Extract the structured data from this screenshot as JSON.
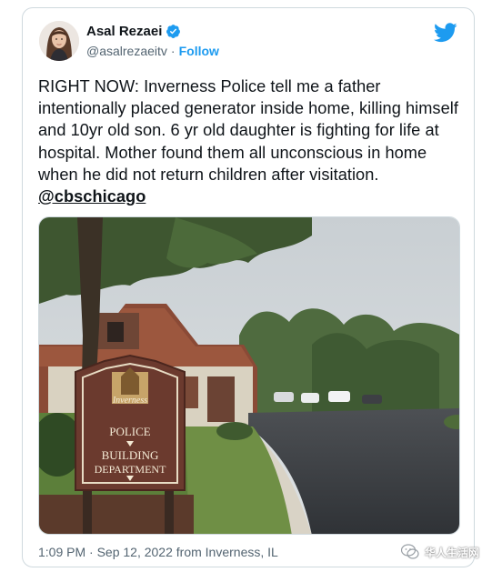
{
  "author": {
    "name": "Asal Rezaei",
    "handle": "@asalrezaeitv",
    "separator": "·",
    "follow_label": "Follow",
    "verified": true
  },
  "tweet": {
    "text": "RIGHT NOW: Inverness Police tell me a father intentionally placed generator inside home, killing himself and 10yr old son. 6 yr old daughter is fighting for life at hospital. Mother found them all unconscious in home when he did not return children after visitation. ",
    "mention": "@cbschicago"
  },
  "photo": {
    "sign_text": {
      "logo": "Inverness",
      "line1": "POLICE",
      "line2": "BUILDING",
      "line3": "DEPARTMENT"
    }
  },
  "meta": {
    "timestamp": "1:09 PM · Sep 12, 2022 from Inverness, IL"
  },
  "watermark": {
    "text": "华人生活网"
  },
  "colors": {
    "accent": "#1d9bf0",
    "text": "#0f1419",
    "muted": "#536471",
    "border": "#cfd9de"
  },
  "icons": {
    "verified": "verified-badge-icon",
    "brand": "twitter-bird-icon",
    "watermark": "wechat-icon"
  }
}
